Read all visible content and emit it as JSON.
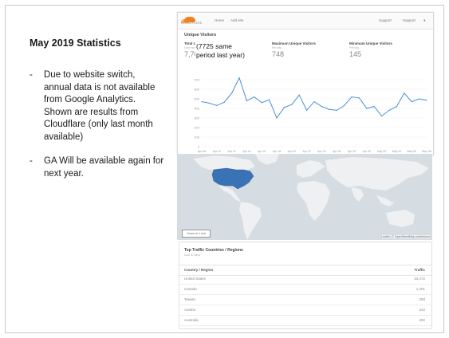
{
  "slide": {
    "title": "May 2019 Statistics",
    "bullets": [
      "Due to website switch, annual data is not available from Google Analytics. Shown are results from Cloudflare (only last month available)",
      "GA Will be available again for next year."
    ],
    "dash": "-"
  },
  "cloudflare": {
    "logo_text": "CLOUDFLARE",
    "nav": [
      "Home",
      "Add site"
    ],
    "nav_right": [
      "Support",
      "Support",
      "user"
    ],
    "section_title": "Unique Visitors",
    "stats": [
      {
        "label": "Total Unique Visitors",
        "sub": "Last month",
        "value": "7,701"
      },
      {
        "label": "Maximum Unique Visitors",
        "sub": "Per day",
        "value": "748"
      },
      {
        "label": "Minimum Unique Visitors",
        "sub": "Per day",
        "value": "145"
      }
    ],
    "overlay_note": [
      "(7725 same",
      "period last year)"
    ],
    "overlay_prefix": "7,70",
    "chart_data": {
      "type": "line",
      "title": "",
      "xlabel": "",
      "ylabel": "",
      "ylim": [
        0,
        800
      ],
      "yticks": [
        0,
        100,
        200,
        300,
        400,
        500,
        600,
        700
      ],
      "x": [
        "Apr 08",
        "Apr 10",
        "Apr 12",
        "Apr 14",
        "Apr 16",
        "Apr 18",
        "Apr 20",
        "Apr 22",
        "Apr 24",
        "Apr 26",
        "Apr 28",
        "Apr 30",
        "May 02",
        "May 04",
        "May 06",
        "May 08"
      ],
      "series": [
        {
          "values": [
            470,
            455,
            430,
            465,
            560,
            720,
            480,
            520,
            460,
            490,
            300,
            410,
            440,
            540,
            380,
            470,
            420,
            390,
            380,
            430,
            520,
            510,
            400,
            420,
            320,
            380,
            420,
            560,
            470,
            500,
            485
          ]
        }
      ]
    }
  },
  "map": {
    "zoom_label": "Zoom in / out",
    "attribution": "Leaflet | © OpenStreetMap contributors"
  },
  "traffic_table": {
    "title": "Top Traffic Countries / Regions",
    "subtitle": "Last 30 days",
    "headers": [
      "Country / Region",
      "Traffic"
    ],
    "rows": [
      {
        "country": "United States",
        "traffic": "34,472"
      },
      {
        "country": "Canada",
        "traffic": "1,201"
      },
      {
        "country": "Taiwan",
        "traffic": "393"
      },
      {
        "country": "Austria",
        "traffic": "242"
      },
      {
        "country": "Australia",
        "traffic": "202"
      }
    ]
  },
  "colors": {
    "line": "#4a90d9",
    "highlight_country": "#3a73b5",
    "land": "#eef0f2",
    "ocean": "#d5dde3",
    "cf_orange": "#f38020"
  }
}
